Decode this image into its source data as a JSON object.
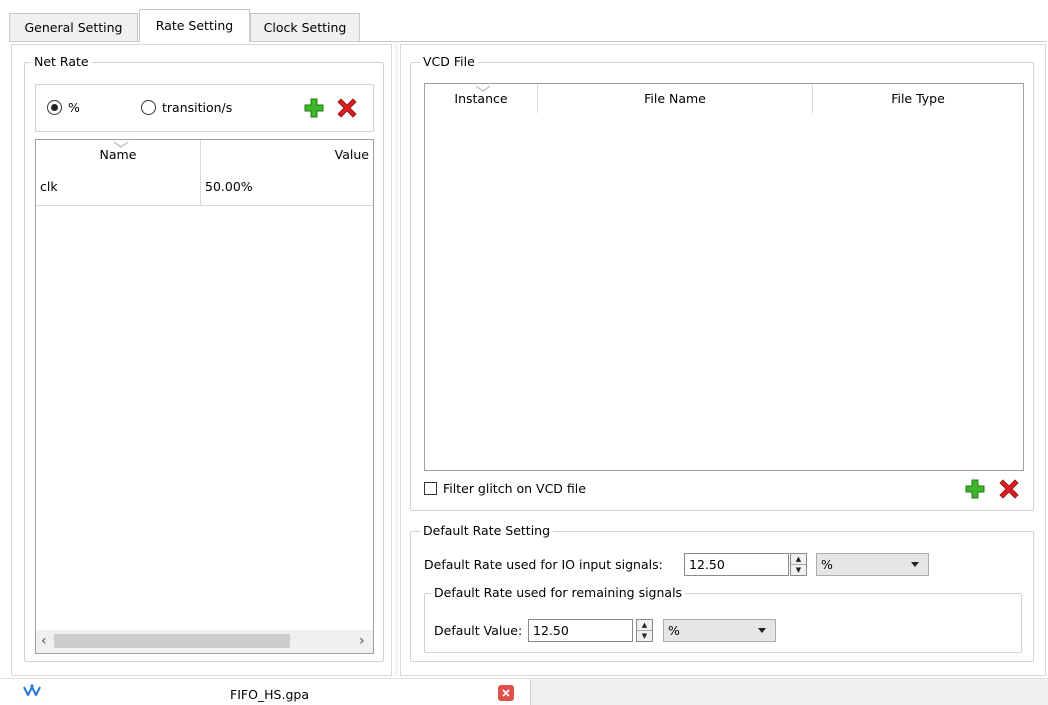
{
  "tabs": [
    {
      "label": "General Setting"
    },
    {
      "label": "Rate Setting"
    },
    {
      "label": "Clock Setting"
    }
  ],
  "net_rate": {
    "title": "Net Rate",
    "radio_percent": "%",
    "radio_transition": "transition/s",
    "selected": "%",
    "table": {
      "columns": [
        "Name",
        "Value"
      ],
      "rows": [
        {
          "name": "clk",
          "value": "50.00%"
        }
      ]
    },
    "scroll_left": "‹",
    "scroll_right": "›"
  },
  "vcd_file": {
    "title": "VCD File",
    "columns": [
      "Instance",
      "File Name",
      "File Type"
    ],
    "filter_label": "Filter glitch on VCD file",
    "filter_checked": false
  },
  "default_rate": {
    "title": "Default Rate Setting",
    "io_label": "Default Rate used for IO input signals:",
    "io_value": "12.50",
    "io_unit": "%",
    "remaining_title": "Default Rate used for remaining signals",
    "value_label": "Default Value:",
    "value": "12.50",
    "value_unit": "%"
  },
  "footer": {
    "file_name": "FIFO_HS.gpa"
  },
  "icons": {
    "add": "plus-icon",
    "remove": "x-icon",
    "app": "logo-icon",
    "close": "close-icon"
  },
  "colors": {
    "add_green": "#3fb52a",
    "remove_red": "#d71f1f",
    "close_red": "#e0504a",
    "app_blue": "#2f7fd8"
  }
}
